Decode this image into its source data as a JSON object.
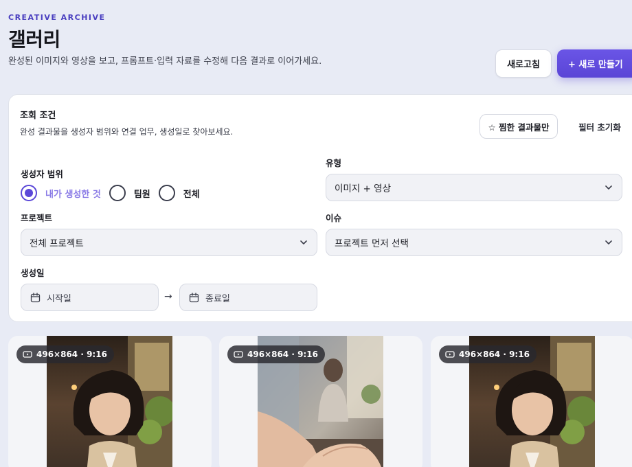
{
  "header": {
    "eyebrow": "CREATIVE ARCHIVE",
    "title": "갤러리",
    "subtitle": "완성된 이미지와 영상을 보고, 프롬프트·입력 자료를 수정해 다음 결과로 이어가세요.",
    "refresh_label": "새로고침",
    "create_label": "+ 새로 만들기"
  },
  "filters": {
    "title": "조회 조건",
    "description": "완성 결과물을 생성자 범위와 연결 업무, 생성일로 찾아보세요.",
    "favorites_label": "☆ 찜한 결과물만",
    "reset_label": "필터 초기화",
    "creator_scope": {
      "label": "생성자 범위",
      "options": [
        "내가 생성한 것",
        "팀원",
        "전체"
      ],
      "selected": "내가 생성한 것"
    },
    "type": {
      "label": "유형",
      "value": "이미지 + 영상"
    },
    "project": {
      "label": "프로젝트",
      "value": "전체 프로젝트"
    },
    "issue": {
      "label": "이슈",
      "value": "프로젝트 먼저 선택"
    },
    "created": {
      "label": "생성일",
      "start_placeholder": "시작일",
      "end_placeholder": "종료일",
      "arrow": "→"
    }
  },
  "results": [
    {
      "badge": "496×864 · 9:16",
      "icon": "video-icon",
      "subject": "woman-reading"
    },
    {
      "badge": "496×864 · 9:16",
      "icon": "video-icon",
      "subject": "hands-typing-cafe"
    },
    {
      "badge": "496×864 · 9:16",
      "icon": "video-icon",
      "subject": "woman-reading"
    }
  ],
  "colors": {
    "accent": "#5b48d8",
    "background": "#e8ebf5",
    "eyebrow": "#4a3fc0"
  }
}
